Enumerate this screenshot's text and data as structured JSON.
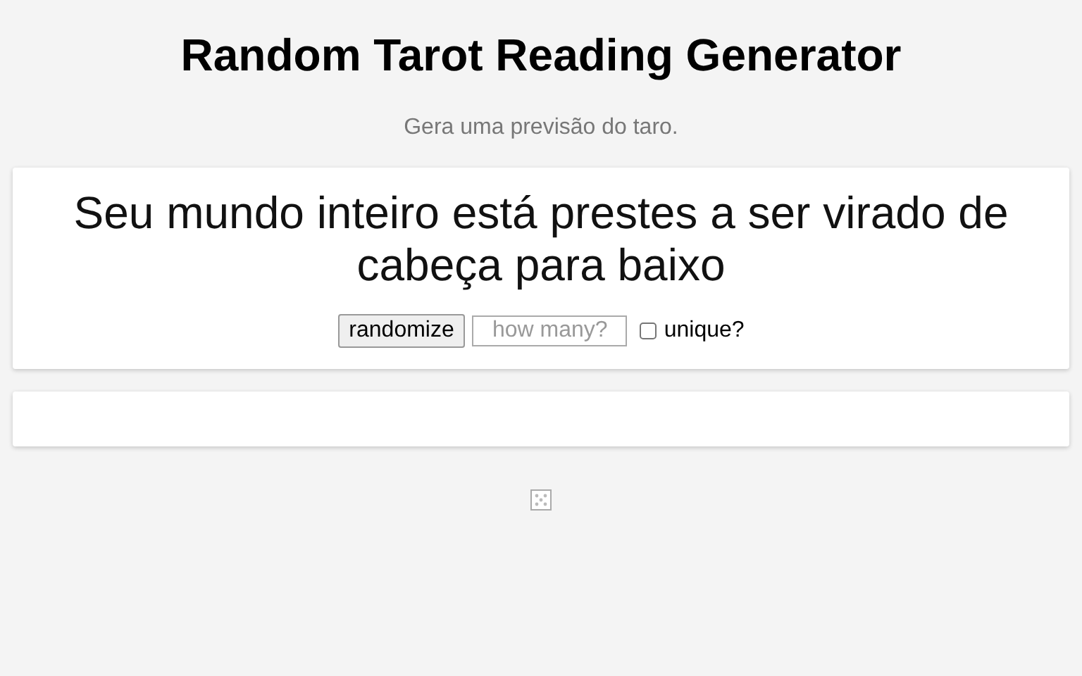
{
  "title": "Random Tarot Reading Generator",
  "subtitle": "Gera uma previsão do taro.",
  "reading": "Seu mundo inteiro está prestes a ser virado de cabeça para baixo",
  "controls": {
    "button": "randomize",
    "count": {
      "placeholder": "how many?"
    },
    "unique": {
      "label": "unique?",
      "checked": false
    }
  }
}
